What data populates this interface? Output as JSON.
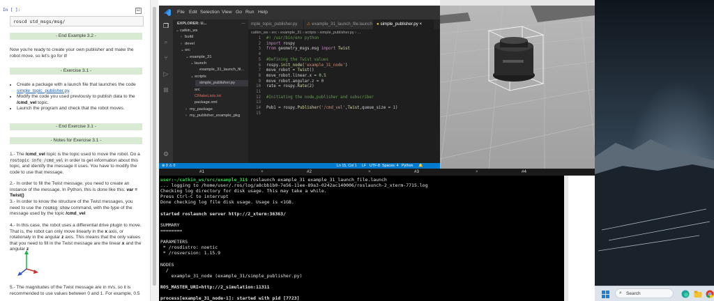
{
  "notebook": {
    "cell_prompt": "In [ ]:",
    "cell_code": "roscd std_msgs/msg/",
    "bar_end_3_2": "- End Example 3.2 -",
    "intro": "Now you're ready to create your own publisher and make the robot move, so let's go for it!",
    "bar_exercise": "- Exercise 3.1 -",
    "ex_item1_a": "Create a package with a launch file that launches the code",
    "ex_item1_link": "simple_topic_publisher.py",
    "ex_item2_a": "Modify the code you used previously to publish data to the",
    "ex_item2_b": "/cmd_vel",
    "ex_item2_c": "topic.",
    "ex_item3": "Launch the program and check that the robot moves.",
    "bar_end_ex": "- End Exercise 3.1 -",
    "bar_notes": "- Notes for Exercise 3.1 -",
    "note1_a": "1.- The",
    "note1_b": "/cmd_vel",
    "note1_c": "topic is the topic used to move the robot. Do a",
    "note1_code": "rostopic info /cmd_vel",
    "note1_d": "in order to get information about this topic, and identify the message it uses. You have to modify the code to use that message.",
    "note2_a": "2.- In order to fill the Twist message, you need to create an instance of the message. In Python, this is done like this:",
    "note2_b": "var = Twist()",
    "note3_a": "3.- In order to know the structure of the Twist messages, you need to use the",
    "note3_code": "rosmsg show",
    "note3_b": "command, with the type of the message used by the topic",
    "note3_c": "/cmd_vel",
    "note4_a": "4.- In this case, the robot uses a differential drive plugin to move. That is, the robot can only move linearly in the",
    "note4_x": "x",
    "note4_b": "axis, or rotationaly in the angular",
    "note4_z": "z",
    "note4_c": "axis. This means that the only values that you need to fill in the Twist message are the linear",
    "note4_and": "and the angular",
    "note5": "5.- The magnitudes of the Twist message are in m/s, so it is recommended to use values between 0 and 1. For example, 0.5"
  },
  "vscode": {
    "menu": [
      "File",
      "Edit",
      "Selection",
      "View",
      "Go",
      "Run",
      "Help"
    ],
    "explorer_title": "EXPLORER: U...",
    "tree": [
      {
        "label": "catkin_ws",
        "arrow": "⌄",
        "indent": 0
      },
      {
        "label": "build",
        "arrow": "›",
        "indent": 1
      },
      {
        "label": "devel",
        "arrow": "›",
        "indent": 1
      },
      {
        "label": "src",
        "arrow": "⌄",
        "indent": 1
      },
      {
        "label": "example_31",
        "arrow": "⌄",
        "indent": 2
      },
      {
        "label": "launch",
        "arrow": "⌄",
        "indent": 3
      },
      {
        "label": "example_31_launch_fil...",
        "arrow": "",
        "indent": 4
      },
      {
        "label": "scripts",
        "arrow": "⌄",
        "indent": 3
      },
      {
        "label": "simple_publisher.py",
        "arrow": "",
        "indent": 4
      },
      {
        "label": "src",
        "arrow": "",
        "indent": 3
      },
      {
        "label": "CMakeLists.txt",
        "arrow": "",
        "indent": 3
      },
      {
        "label": "package.xml",
        "arrow": "",
        "indent": 3
      },
      {
        "label": "my_package",
        "arrow": "›",
        "indent": 2
      },
      {
        "label": "my_publisher_example_pkg",
        "arrow": "›",
        "indent": 2
      }
    ],
    "tabs": [
      "mple_topic_publisher.py",
      "example_31_launch_file.launch",
      "simple_publisher.py"
    ],
    "breadcrumb": "catkin_ws  ›  src  ›  example_31  ›  scripts  ›  simple_publisher.py  ›  ...",
    "code_lines": [
      {
        "n": "1",
        "t": "#! /usr/bin/env python",
        "c": "cm"
      },
      {
        "n": "2",
        "t": "import rospy",
        "c": "kw"
      },
      {
        "n": "3",
        "t": "from geometry_msgs.msg import Twist",
        "c": "kw"
      },
      {
        "n": "4",
        "t": "",
        "c": ""
      },
      {
        "n": "5",
        "t": "#Defining the Twist values",
        "c": "cm"
      },
      {
        "n": "6",
        "t": "rospy.init_node('example_31_node')",
        "c": "fn"
      },
      {
        "n": "7",
        "t": "move_robot = Twist()",
        "c": "vr"
      },
      {
        "n": "8",
        "t": "move_robot.linear.x = 0.5",
        "c": "vr"
      },
      {
        "n": "9",
        "t": "move_robot.angular.z = 0",
        "c": "vr"
      },
      {
        "n": "10",
        "t": "rate = rospy.Rate(2)",
        "c": "vr"
      },
      {
        "n": "11",
        "t": "",
        "c": ""
      },
      {
        "n": "12",
        "t": "#Initiating the node,publisher and subscriber",
        "c": "cm"
      },
      {
        "n": "13",
        "t": "",
        "c": ""
      },
      {
        "n": "14",
        "t": "Pub1 = rospy.Publisher('/cmd_vel',Twist,queue_size = 1)",
        "c": "vr"
      },
      {
        "n": "15",
        "t": "",
        "c": ""
      }
    ],
    "status_left": "⊗ 0 ⚠ 0",
    "status_pos": "Ln 15, Col 1",
    "status_eol": "LF",
    "status_enc": "UTF-8",
    "status_spaces": "Spaces: 4",
    "status_lang": "Python"
  },
  "tmux_tabs": [
    "#1",
    "#2",
    "#3",
    "#4"
  ],
  "terminal_lines": [
    {
      "t": "user:~/catkin_ws/src/example_31$ roslaunch example_31 example_31_launch_file.launch",
      "c": "prompt"
    },
    {
      "t": "... logging to /home/user/.ros/log/a8cbb1b0-7e56-11ee-89a3-0242ac140006/roslaunch-2_xterm-7715.log",
      "c": ""
    },
    {
      "t": "Checking log directory for disk usage. This may take a while.",
      "c": ""
    },
    {
      "t": "Press Ctrl-C to interrupt",
      "c": ""
    },
    {
      "t": "Done checking log file disk usage. Usage is <1GB.",
      "c": ""
    },
    {
      "t": "",
      "c": ""
    },
    {
      "t": "started roslaunch server http://2_xterm:36363/",
      "c": "bold"
    },
    {
      "t": "",
      "c": ""
    },
    {
      "t": "SUMMARY",
      "c": ""
    },
    {
      "t": "========",
      "c": ""
    },
    {
      "t": "",
      "c": ""
    },
    {
      "t": "PARAMETERS",
      "c": ""
    },
    {
      "t": " * /rosdistro: noetic",
      "c": ""
    },
    {
      "t": " * /rosversion: 1.15.9",
      "c": ""
    },
    {
      "t": "",
      "c": ""
    },
    {
      "t": "NODES",
      "c": ""
    },
    {
      "t": "  /",
      "c": ""
    },
    {
      "t": "    example_31_node (example_31/simple_publisher.py)",
      "c": ""
    },
    {
      "t": "",
      "c": ""
    },
    {
      "t": "ROS_MASTER_URI=http://2_simulation:11311",
      "c": "bold"
    },
    {
      "t": "",
      "c": ""
    },
    {
      "t": "process[example_31_node-1]: started with pid [7723]",
      "c": "bold"
    }
  ],
  "taskbar": {
    "search_placeholder": "Search"
  }
}
